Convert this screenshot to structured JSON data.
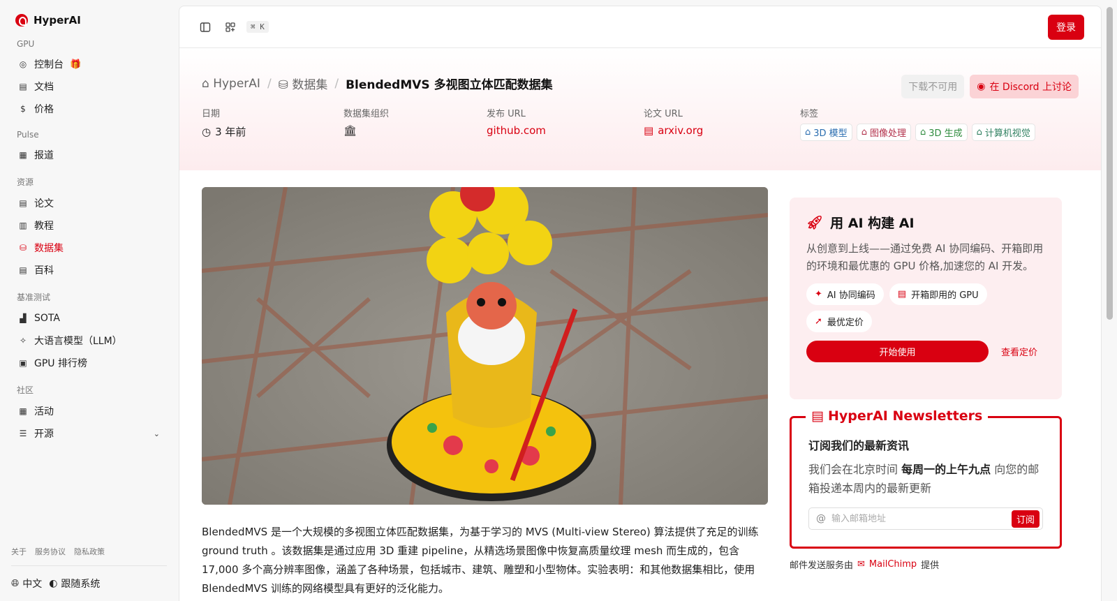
{
  "brand": {
    "name": "HyperAI"
  },
  "sidebar": {
    "sections": [
      {
        "title": "GPU",
        "items": [
          {
            "label": "控制台",
            "icon": "gauge-icon",
            "badge": "gift-icon"
          },
          {
            "label": "文档",
            "icon": "doc-icon"
          },
          {
            "label": "价格",
            "icon": "dollar-icon"
          }
        ]
      },
      {
        "title": "Pulse",
        "items": [
          {
            "label": "报道",
            "icon": "news-icon"
          }
        ]
      },
      {
        "title": "资源",
        "items": [
          {
            "label": "论文",
            "icon": "paper-icon"
          },
          {
            "label": "教程",
            "icon": "book-icon"
          },
          {
            "label": "数据集",
            "icon": "database-icon",
            "active": true
          },
          {
            "label": "百科",
            "icon": "wiki-icon"
          }
        ]
      },
      {
        "title": "基准测试",
        "items": [
          {
            "label": "SOTA",
            "icon": "chart-icon"
          },
          {
            "label": "大语言模型（LLM）",
            "icon": "sparkle-icon"
          },
          {
            "label": "GPU 排行榜",
            "icon": "chip-icon"
          }
        ]
      },
      {
        "title": "社区",
        "items": [
          {
            "label": "活动",
            "icon": "calendar-icon"
          },
          {
            "label": "开源",
            "icon": "list-icon",
            "expandable": true
          }
        ]
      }
    ],
    "footer_links": [
      "关于",
      "服务协议",
      "隐私政策"
    ],
    "language": "中文",
    "theme": "跟随系统"
  },
  "topbar": {
    "shortcut": "⌘ K",
    "login_label": "登录"
  },
  "breadcrumb": {
    "home": "HyperAI",
    "section": "数据集",
    "current": "BlendedMVS 多视图立体匹配数据集"
  },
  "header_actions": {
    "download": "下载不可用",
    "discord": "在 Discord 上讨论"
  },
  "meta": {
    "date_label": "日期",
    "date_value": "3 年前",
    "org_label": "数据集组织",
    "release_label": "发布 URL",
    "release_value": "github.com",
    "paper_label": "论文 URL",
    "paper_value": "arxiv.org",
    "tags_label": "标签",
    "tags": [
      "3D 模型",
      "图像处理",
      "3D 生成",
      "计算机视觉"
    ]
  },
  "description": "BlendedMVS 是一个大规模的多视图立体匹配数据集，为基于学习的 MVS (Multi-view Stereo) 算法提供了充足的训练 ground truth 。该数据集是通过应用 3D 重建 pipeline，从精选场景图像中恢复高质量纹理 mesh 而生成的，包含 17,000 多个高分辨率图像，涵盖了各种场景，包括城市、建筑、雕塑和小型物体。实验表明：和其他数据集相比，使用 BlendedMVS 训练的网络模型具有更好的泛化能力。",
  "cta": {
    "title": "用 AI 构建 AI",
    "text": "从创意到上线——通过免费 AI 协同编码、开箱即用的环境和最优惠的 GPU 价格,加速您的 AI 开发。",
    "chips": [
      "AI 协同编码",
      "开箱即用的 GPU",
      "最优定价"
    ],
    "start_label": "开始使用",
    "pricing_label": "查看定价"
  },
  "newsletter": {
    "legend": "HyperAI Newsletters",
    "subtitle": "订阅我们的最新资讯",
    "text_before": "我们会在北京时间 ",
    "text_bold": "每周一的上午九点",
    "text_after": " 向您的邮箱投递本周内的最新更新",
    "placeholder": "输入邮箱地址",
    "subscribe_label": "订阅"
  },
  "mail_note": {
    "prefix": "邮件发送服务由",
    "provider": "MailChimp",
    "suffix": "提供"
  },
  "colors": {
    "brand": "#d90011",
    "active_nav": "#d90011",
    "cta_bg": "#fdeef0"
  }
}
